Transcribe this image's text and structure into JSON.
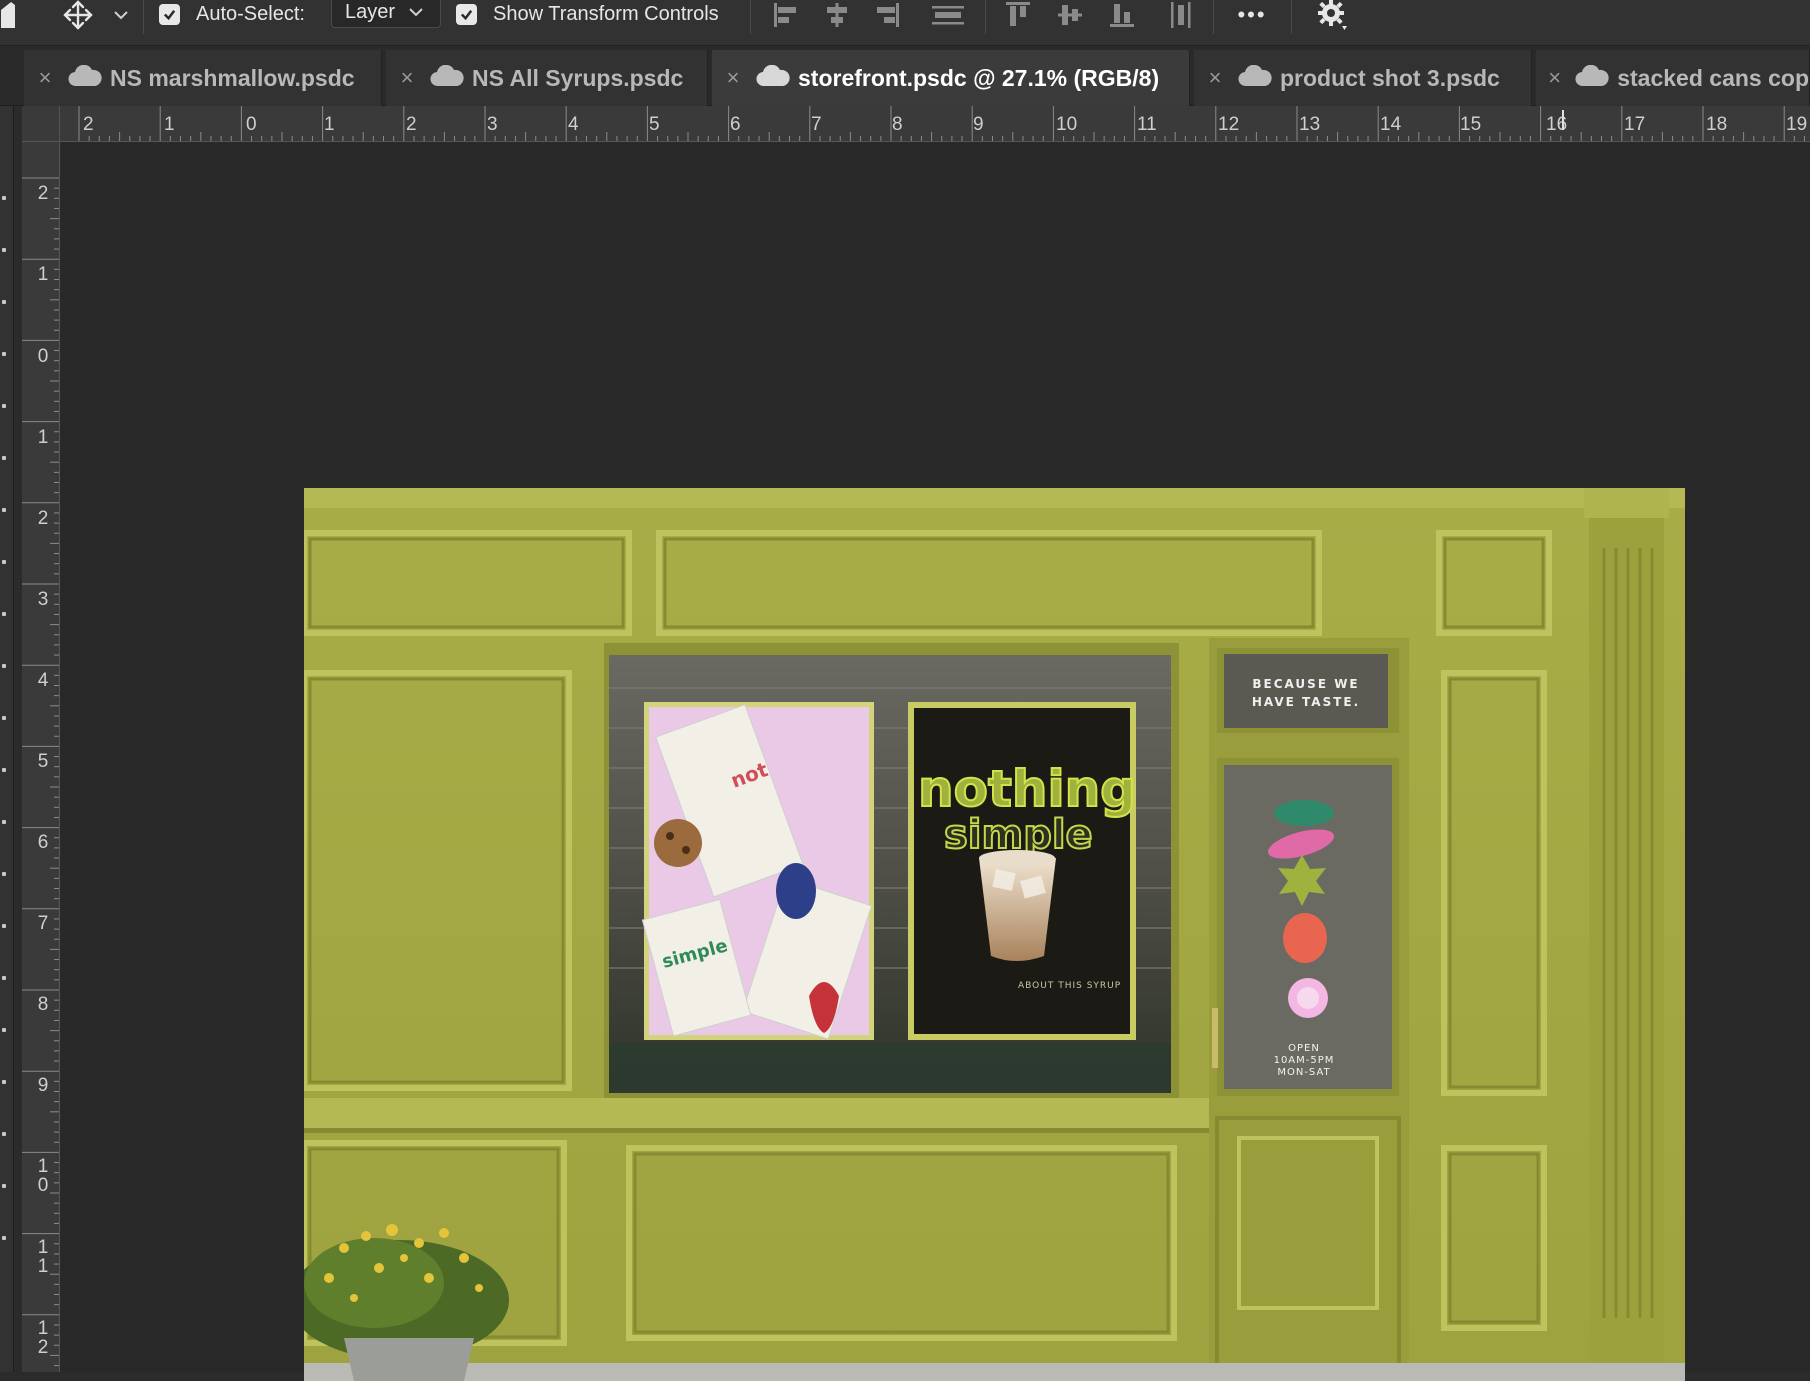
{
  "options_bar": {
    "auto_select_label": "Auto-Select:",
    "auto_select_checked": true,
    "auto_select_target": "Layer",
    "show_transform_label": "Show Transform Controls",
    "show_transform_checked": true,
    "more_label": "•••"
  },
  "tabs": [
    {
      "label": "NS marshmallow.psdc",
      "active": false
    },
    {
      "label": "NS All Syrups.psdc",
      "active": false
    },
    {
      "label": "storefront.psdc @ 27.1% (RGB/8)",
      "active": true
    },
    {
      "label": "product shot 3.psdc",
      "active": false
    },
    {
      "label": "stacked cans cop",
      "active": false
    }
  ],
  "ruler": {
    "horizontal_labels": [
      "2",
      "1",
      "0",
      "1",
      "2",
      "3",
      "4",
      "5",
      "6",
      "7",
      "8",
      "9",
      "10",
      "11",
      "12",
      "13",
      "14",
      "15",
      "16",
      "17",
      "18",
      "19"
    ],
    "vertical_labels": [
      "2",
      "1",
      "0",
      "1",
      "2",
      "3",
      "4",
      "5",
      "6",
      "7",
      "8",
      "9",
      "10",
      "11",
      "12"
    ]
  },
  "document": {
    "window_sign": [
      "BECAUSE WE",
      "HAVE TASTE."
    ],
    "poster_brand": "nothing simple",
    "poster_footer": "ABOUT THIS SYRUP",
    "door_hours": [
      "OPEN",
      "10AM-5PM",
      "MON-SAT"
    ],
    "colors": {
      "facade": "#a7ab45",
      "facade_dark": "#8e9236",
      "poster_pink": "#e9c9e6",
      "poster_dark": "#1b1a14"
    }
  }
}
